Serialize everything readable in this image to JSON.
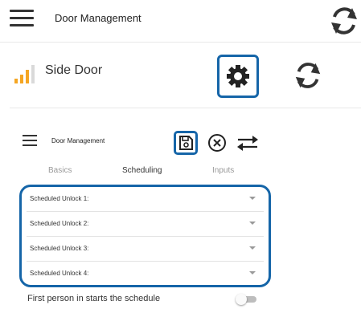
{
  "header": {
    "title": "Door Management",
    "menu_icon": "hamburger-menu-icon",
    "refresh_icon": "refresh-icon"
  },
  "door": {
    "name": "Side Door",
    "signal_icon": "signal-strength-icon",
    "settings_icon": "gear-icon",
    "refresh_icon": "refresh-icon"
  },
  "editor": {
    "title": "Door Management",
    "save_icon": "save-icon",
    "cancel_icon": "cancel-circle-icon",
    "swap_icon": "swap-arrows-icon"
  },
  "tabs": [
    {
      "label": "Basics",
      "active": false
    },
    {
      "label": "Scheduling",
      "active": true
    },
    {
      "label": "Inputs",
      "active": false
    }
  ],
  "schedules": [
    {
      "label": "Scheduled Unlock 1:"
    },
    {
      "label": "Scheduled Unlock 2:"
    },
    {
      "label": "Scheduled Unlock 3:"
    },
    {
      "label": "Scheduled Unlock 4:"
    }
  ],
  "first_person": {
    "label": "First person in starts the schedule",
    "enabled": false
  },
  "colors": {
    "highlight": "#1565a8",
    "signal_orange": "#f5a623",
    "signal_empty": "#d9d9d9"
  }
}
